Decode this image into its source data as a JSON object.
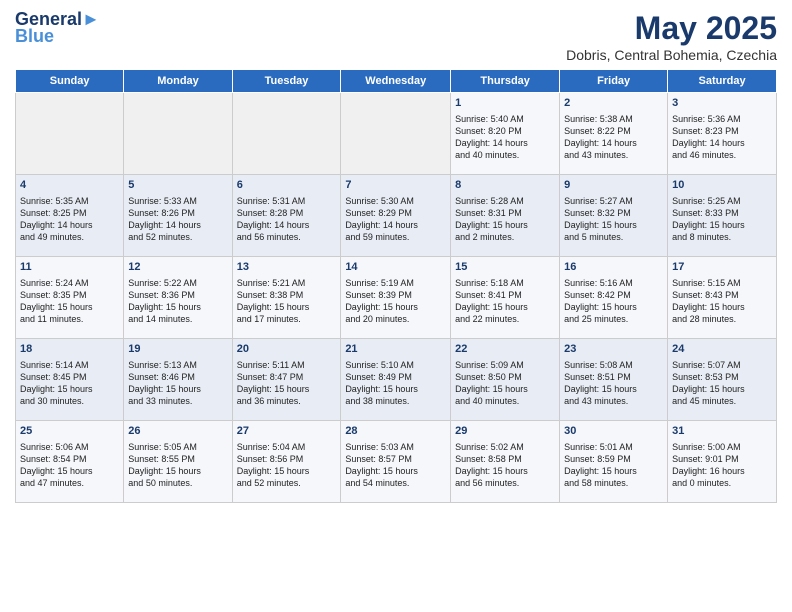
{
  "header": {
    "logo_line1": "General",
    "logo_line2": "Blue",
    "title": "May 2025",
    "subtitle": "Dobris, Central Bohemia, Czechia"
  },
  "days_of_week": [
    "Sunday",
    "Monday",
    "Tuesday",
    "Wednesday",
    "Thursday",
    "Friday",
    "Saturday"
  ],
  "weeks": [
    [
      {
        "day": "",
        "content": ""
      },
      {
        "day": "",
        "content": ""
      },
      {
        "day": "",
        "content": ""
      },
      {
        "day": "",
        "content": ""
      },
      {
        "day": "1",
        "content": "Sunrise: 5:40 AM\nSunset: 8:20 PM\nDaylight: 14 hours\nand 40 minutes."
      },
      {
        "day": "2",
        "content": "Sunrise: 5:38 AM\nSunset: 8:22 PM\nDaylight: 14 hours\nand 43 minutes."
      },
      {
        "day": "3",
        "content": "Sunrise: 5:36 AM\nSunset: 8:23 PM\nDaylight: 14 hours\nand 46 minutes."
      }
    ],
    [
      {
        "day": "4",
        "content": "Sunrise: 5:35 AM\nSunset: 8:25 PM\nDaylight: 14 hours\nand 49 minutes."
      },
      {
        "day": "5",
        "content": "Sunrise: 5:33 AM\nSunset: 8:26 PM\nDaylight: 14 hours\nand 52 minutes."
      },
      {
        "day": "6",
        "content": "Sunrise: 5:31 AM\nSunset: 8:28 PM\nDaylight: 14 hours\nand 56 minutes."
      },
      {
        "day": "7",
        "content": "Sunrise: 5:30 AM\nSunset: 8:29 PM\nDaylight: 14 hours\nand 59 minutes."
      },
      {
        "day": "8",
        "content": "Sunrise: 5:28 AM\nSunset: 8:31 PM\nDaylight: 15 hours\nand 2 minutes."
      },
      {
        "day": "9",
        "content": "Sunrise: 5:27 AM\nSunset: 8:32 PM\nDaylight: 15 hours\nand 5 minutes."
      },
      {
        "day": "10",
        "content": "Sunrise: 5:25 AM\nSunset: 8:33 PM\nDaylight: 15 hours\nand 8 minutes."
      }
    ],
    [
      {
        "day": "11",
        "content": "Sunrise: 5:24 AM\nSunset: 8:35 PM\nDaylight: 15 hours\nand 11 minutes."
      },
      {
        "day": "12",
        "content": "Sunrise: 5:22 AM\nSunset: 8:36 PM\nDaylight: 15 hours\nand 14 minutes."
      },
      {
        "day": "13",
        "content": "Sunrise: 5:21 AM\nSunset: 8:38 PM\nDaylight: 15 hours\nand 17 minutes."
      },
      {
        "day": "14",
        "content": "Sunrise: 5:19 AM\nSunset: 8:39 PM\nDaylight: 15 hours\nand 20 minutes."
      },
      {
        "day": "15",
        "content": "Sunrise: 5:18 AM\nSunset: 8:41 PM\nDaylight: 15 hours\nand 22 minutes."
      },
      {
        "day": "16",
        "content": "Sunrise: 5:16 AM\nSunset: 8:42 PM\nDaylight: 15 hours\nand 25 minutes."
      },
      {
        "day": "17",
        "content": "Sunrise: 5:15 AM\nSunset: 8:43 PM\nDaylight: 15 hours\nand 28 minutes."
      }
    ],
    [
      {
        "day": "18",
        "content": "Sunrise: 5:14 AM\nSunset: 8:45 PM\nDaylight: 15 hours\nand 30 minutes."
      },
      {
        "day": "19",
        "content": "Sunrise: 5:13 AM\nSunset: 8:46 PM\nDaylight: 15 hours\nand 33 minutes."
      },
      {
        "day": "20",
        "content": "Sunrise: 5:11 AM\nSunset: 8:47 PM\nDaylight: 15 hours\nand 36 minutes."
      },
      {
        "day": "21",
        "content": "Sunrise: 5:10 AM\nSunset: 8:49 PM\nDaylight: 15 hours\nand 38 minutes."
      },
      {
        "day": "22",
        "content": "Sunrise: 5:09 AM\nSunset: 8:50 PM\nDaylight: 15 hours\nand 40 minutes."
      },
      {
        "day": "23",
        "content": "Sunrise: 5:08 AM\nSunset: 8:51 PM\nDaylight: 15 hours\nand 43 minutes."
      },
      {
        "day": "24",
        "content": "Sunrise: 5:07 AM\nSunset: 8:53 PM\nDaylight: 15 hours\nand 45 minutes."
      }
    ],
    [
      {
        "day": "25",
        "content": "Sunrise: 5:06 AM\nSunset: 8:54 PM\nDaylight: 15 hours\nand 47 minutes."
      },
      {
        "day": "26",
        "content": "Sunrise: 5:05 AM\nSunset: 8:55 PM\nDaylight: 15 hours\nand 50 minutes."
      },
      {
        "day": "27",
        "content": "Sunrise: 5:04 AM\nSunset: 8:56 PM\nDaylight: 15 hours\nand 52 minutes."
      },
      {
        "day": "28",
        "content": "Sunrise: 5:03 AM\nSunset: 8:57 PM\nDaylight: 15 hours\nand 54 minutes."
      },
      {
        "day": "29",
        "content": "Sunrise: 5:02 AM\nSunset: 8:58 PM\nDaylight: 15 hours\nand 56 minutes."
      },
      {
        "day": "30",
        "content": "Sunrise: 5:01 AM\nSunset: 8:59 PM\nDaylight: 15 hours\nand 58 minutes."
      },
      {
        "day": "31",
        "content": "Sunrise: 5:00 AM\nSunset: 9:01 PM\nDaylight: 16 hours\nand 0 minutes."
      }
    ]
  ]
}
